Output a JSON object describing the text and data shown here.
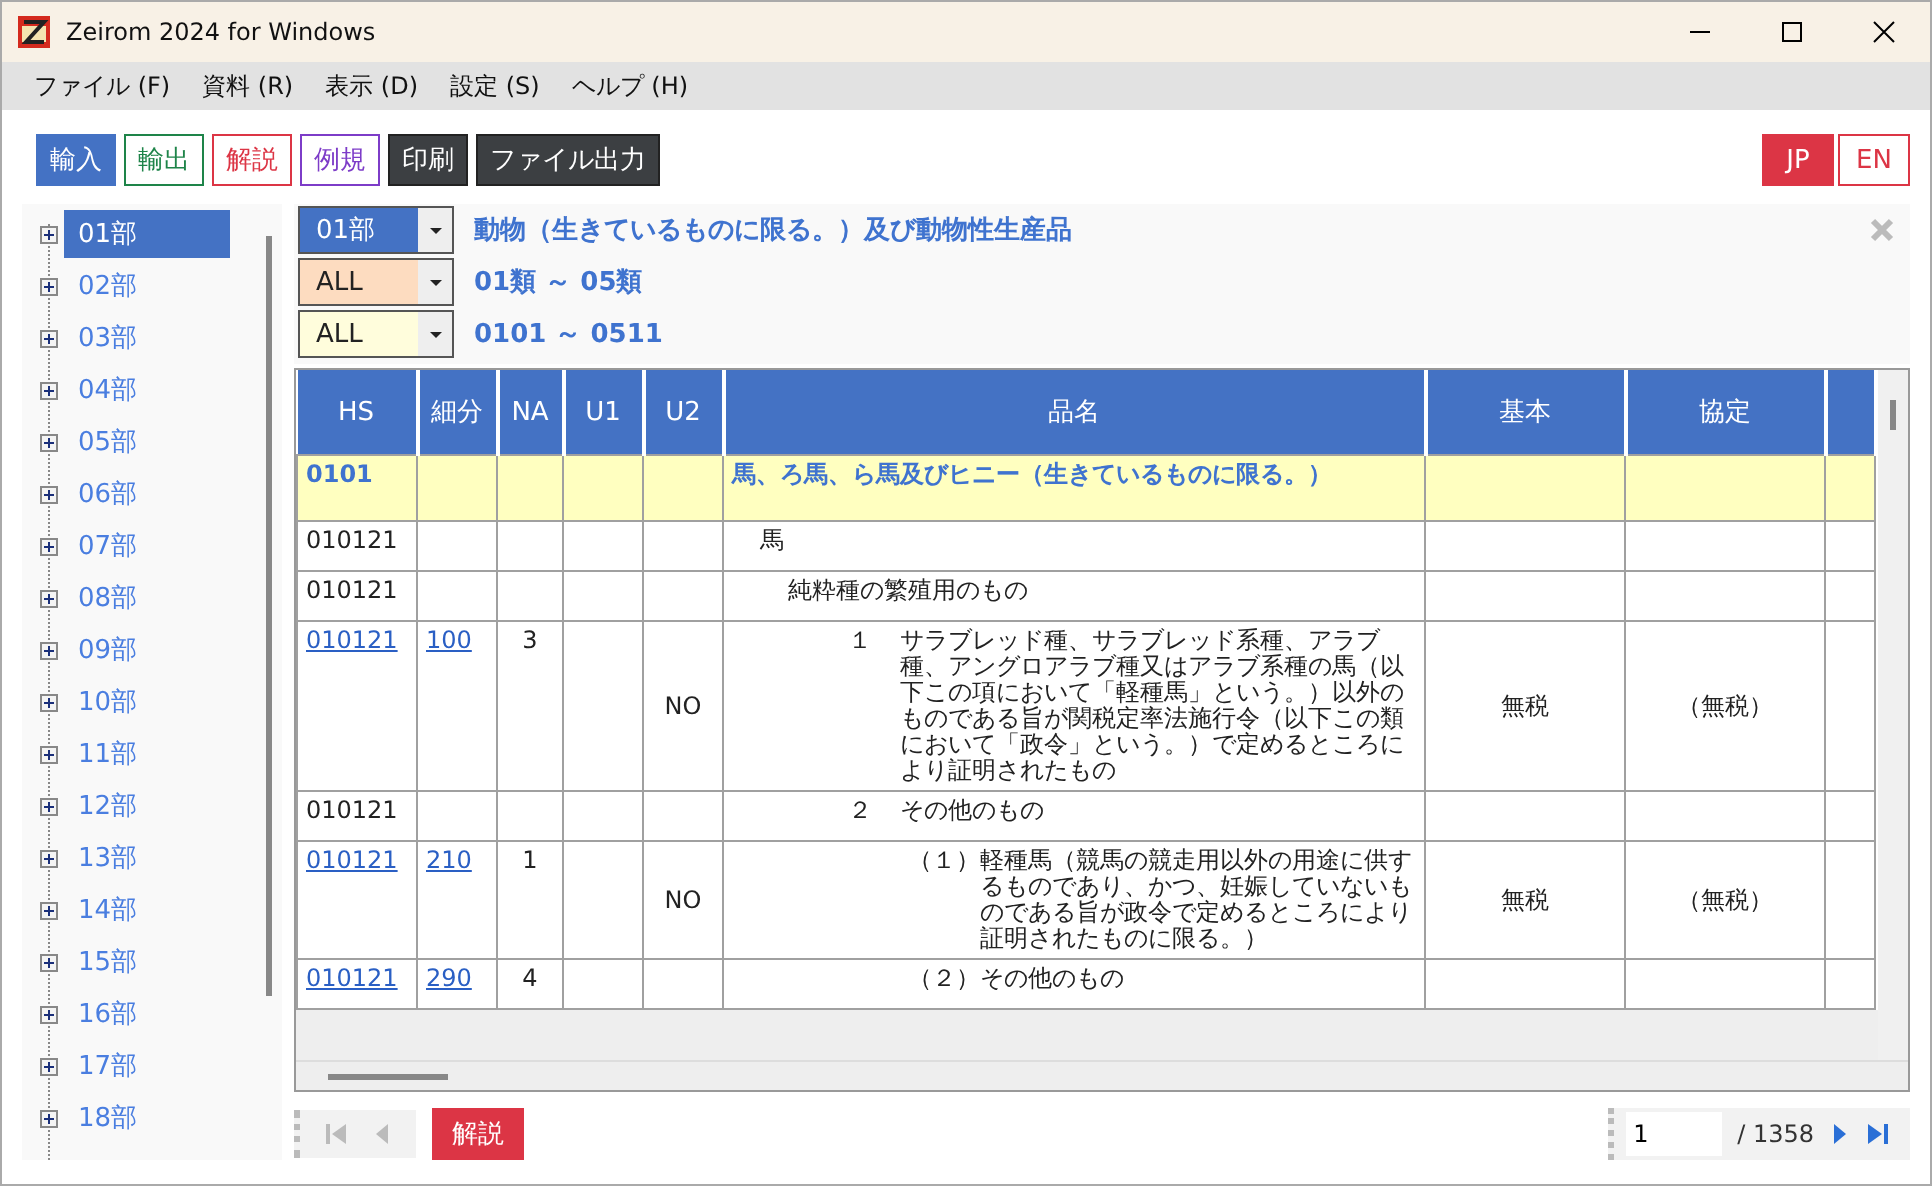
{
  "window": {
    "title": "Zeirom 2024 for Windows"
  },
  "menu": [
    {
      "label": "ファイル (F)"
    },
    {
      "label": "資料 (R)"
    },
    {
      "label": "表示 (D)"
    },
    {
      "label": "設定 (S)"
    },
    {
      "label": "ヘルプ (H)"
    }
  ],
  "toolbar": [
    {
      "label": "輸入",
      "kind": "mode",
      "color": "#4472c4",
      "selected": true
    },
    {
      "label": "輸出",
      "kind": "mode",
      "color": "#1e8449",
      "selected": false
    },
    {
      "label": "解説",
      "kind": "mode",
      "color": "#dc3545",
      "selected": false
    },
    {
      "label": "例規",
      "kind": "mode",
      "color": "#7d3cc8",
      "selected": false
    },
    {
      "label": "印刷",
      "kind": "action"
    },
    {
      "label": "ファイル出力",
      "kind": "action"
    }
  ],
  "languages": [
    {
      "label": "JP",
      "selected": true
    },
    {
      "label": "EN",
      "selected": false
    }
  ],
  "tree": [
    {
      "label": "01部",
      "selected": true,
      "expanded": false
    },
    {
      "label": "02部",
      "selected": false,
      "expanded": false
    },
    {
      "label": "03部",
      "selected": false,
      "expanded": false
    },
    {
      "label": "04部",
      "selected": false,
      "expanded": false
    },
    {
      "label": "05部",
      "selected": false,
      "expanded": false
    },
    {
      "label": "06部",
      "selected": false,
      "expanded": false
    },
    {
      "label": "07部",
      "selected": false,
      "expanded": false
    },
    {
      "label": "08部",
      "selected": false,
      "expanded": false
    },
    {
      "label": "09部",
      "selected": false,
      "expanded": false
    },
    {
      "label": "10部",
      "selected": false,
      "expanded": false
    },
    {
      "label": "11部",
      "selected": false,
      "expanded": false
    },
    {
      "label": "12部",
      "selected": false,
      "expanded": false
    },
    {
      "label": "13部",
      "selected": false,
      "expanded": false
    },
    {
      "label": "14部",
      "selected": false,
      "expanded": false
    },
    {
      "label": "15部",
      "selected": false,
      "expanded": false
    },
    {
      "label": "16部",
      "selected": false,
      "expanded": false
    },
    {
      "label": "17部",
      "selected": false,
      "expanded": false
    },
    {
      "label": "18部",
      "selected": false,
      "expanded": false
    }
  ],
  "filters": [
    {
      "value": "01部",
      "color": "#4472c4",
      "range": "動物（生きているものに限る。）及び動物性生産品"
    },
    {
      "value": "ALL",
      "color": "#fddcc0",
      "range": "01類 ～ 05類"
    },
    {
      "value": "ALL",
      "color": "#fffddc",
      "range": "0101 ～ 0511"
    }
  ],
  "table": {
    "columns": [
      "HS",
      "細分",
      "NA",
      "U1",
      "U2",
      "品名",
      "基本",
      "協定"
    ],
    "rows": [
      {
        "kind": "heading",
        "hs": "0101",
        "name": "馬、ろ馬、ら馬及びヒニー（生きているものに限る。）",
        "children": [
          {
            "kind": "item",
            "hs": "010121",
            "link": false,
            "name": "馬",
            "children": [
              {
                "kind": "item",
                "hs": "010121",
                "link": false,
                "name": "純粋種の繁殖用のもの",
                "children": [
                  {
                    "kind": "item",
                    "hs": "010121",
                    "link": true,
                    "sub": "100",
                    "na": "3",
                    "u2": "NO",
                    "number": "１",
                    "name": "サラブレッド種、サラブレッド系種、アラブ種、アングロアラブ種又はアラブ系種の馬（以下この項において「軽種馬」という。）以外のものである旨が関税定率法施行令（以下この類において「政令」という。）で定めるところにより証明されたもの",
                    "basic": "無税",
                    "agreement": "（無税）"
                  },
                  {
                    "kind": "item",
                    "hs": "010121",
                    "link": false,
                    "number": "２",
                    "name": "その他のもの",
                    "children": [
                      {
                        "kind": "item",
                        "hs": "010121",
                        "link": true,
                        "sub": "210",
                        "na": "1",
                        "u2": "NO",
                        "number": "（１）",
                        "name": "軽種馬（競馬の競走用以外の用途に供するものであり、かつ、妊娠していないものである旨が政令で定めるところにより証明されたものに限る。）",
                        "basic": "無税",
                        "agreement": "（無税）"
                      },
                      {
                        "kind": "item",
                        "hs": "010121",
                        "link": true,
                        "sub": "290",
                        "na": "4",
                        "number": "（２）",
                        "name": "その他のもの"
                      }
                    ]
                  }
                ]
              }
            ]
          }
        ]
      }
    ]
  },
  "pager": {
    "button": "解説",
    "page": "1",
    "total": "/ 1358"
  }
}
